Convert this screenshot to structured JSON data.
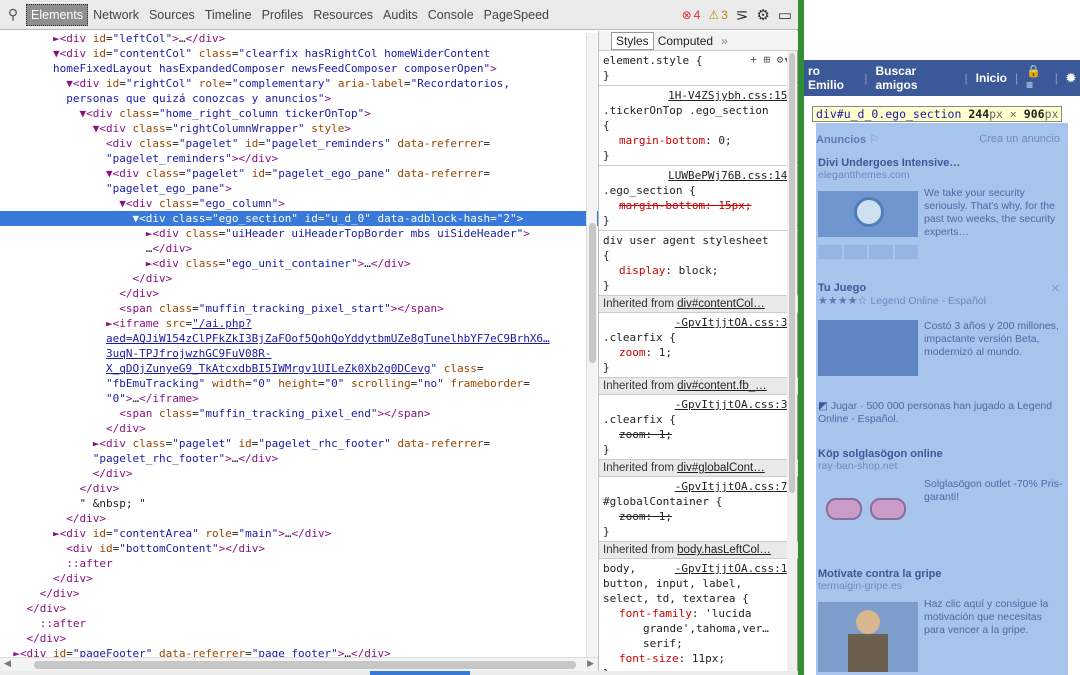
{
  "toolbar": {
    "tabs": [
      "Elements",
      "Network",
      "Sources",
      "Timeline",
      "Profiles",
      "Resources",
      "Audits",
      "Console",
      "PageSpeed"
    ],
    "errors": "4",
    "warnings": "3"
  },
  "dom_lines": [
    {
      "html": "        <span class='tg'>&#9658;&lt;div</span> <span class='an'>id</span>=<span class='av'>\"leftCol\"</span><span class='tg'>&gt;</span>…<span class='tg'>&lt;/div&gt;</span>"
    },
    {
      "html": "        <span class='tg'>&#9660;&lt;div</span> <span class='an'>id</span>=<span class='av'>\"contentCol\"</span> <span class='an'>class</span>=<span class='av'>\"clearfix hasRightCol homeWiderContent</span>"
    },
    {
      "html": "        <span class='av'>homeFixedLayout hasExpandedComposer newsFeedComposer composerOpen\"</span><span class='tg'>&gt;</span>"
    },
    {
      "html": "          <span class='tg'>&#9660;&lt;div</span> <span class='an'>id</span>=<span class='av'>\"rightCol\"</span> <span class='an'>role</span>=<span class='av'>\"complementary\"</span> <span class='an'>aria-label</span>=<span class='av'>\"Recordatorios,</span>"
    },
    {
      "html": "          <span class='av'>personas que quizá conozcas y anuncios\"</span><span class='tg'>&gt;</span>"
    },
    {
      "html": "            <span class='tg'>&#9660;&lt;div</span> <span class='an'>class</span>=<span class='av'>\"home_right_column tickerOnTop\"</span><span class='tg'>&gt;</span>"
    },
    {
      "html": "              <span class='tg'>&#9660;&lt;div</span> <span class='an'>class</span>=<span class='av'>\"rightColumnWrapper\"</span> <span class='an'>style</span><span class='tg'>&gt;</span>"
    },
    {
      "html": "                <span class='tg'>&lt;div</span> <span class='an'>class</span>=<span class='av'>\"pagelet\"</span> <span class='an'>id</span>=<span class='av'>\"pagelet_reminders\"</span> <span class='an'>data-referrer</span>="
    },
    {
      "html": "                <span class='av'>\"pagelet_reminders\"</span><span class='tg'>&gt;&lt;/div&gt;</span>"
    },
    {
      "html": "                <span class='tg'>&#9660;&lt;div</span> <span class='an'>class</span>=<span class='av'>\"pagelet\"</span> <span class='an'>id</span>=<span class='av'>\"pagelet_ego_pane\"</span> <span class='an'>data-referrer</span>="
    },
    {
      "html": "                <span class='av'>\"pagelet_ego_pane\"</span><span class='tg'>&gt;</span>"
    },
    {
      "html": "                  <span class='tg'>&#9660;&lt;div</span> <span class='an'>class</span>=<span class='av'>\"ego_column\"</span><span class='tg'>&gt;</span>"
    },
    {
      "html": "                    <span class='tg'>&#9660;&lt;div</span> <span class='an'>class</span>=<span class='av'>\"ego_section\"</span> <span class='an'>id</span>=<span class='av'>\"u_d_0\"</span> <span class='an'>data-adblock-hash</span>=<span class='av'>\"2\"</span><span class='tg'>&gt;</span>",
      "selected": true
    },
    {
      "html": "                      <span class='tg'>&#9658;&lt;div</span> <span class='an'>class</span>=<span class='av'>\"uiHeader uiHeaderTopBorder mbs uiSideHeader\"</span><span class='tg'>&gt;</span>"
    },
    {
      "html": "                      …<span class='tg'>&lt;/div&gt;</span>"
    },
    {
      "html": "                      <span class='tg'>&#9658;&lt;div</span> <span class='an'>class</span>=<span class='av'>\"ego_unit_container\"</span><span class='tg'>&gt;</span>…<span class='tg'>&lt;/div&gt;</span>"
    },
    {
      "html": "                    <span class='tg'>&lt;/div&gt;</span>"
    },
    {
      "html": "                  <span class='tg'>&lt;/div&gt;</span>"
    },
    {
      "html": "                  <span class='tg'>&lt;span</span> <span class='an'>class</span>=<span class='av'>\"muffin_tracking_pixel_start\"</span><span class='tg'>&gt;&lt;/span&gt;</span>"
    },
    {
      "html": "                <span class='tg'>&#9658;&lt;iframe</span> <span class='an'>src</span>=<span class='lk'>\"/ai.php?</span>"
    },
    {
      "html": "                <span class='lk'>aed=AQJiW154zClPFkZkI3BjZaFOof5QohQoYddytbmUZe8gTunelhbYF7eC9BrhX6…</span>"
    },
    {
      "html": "                <span class='lk'>3uqN-TPJfrojwzhGC9FuV08R-</span>"
    },
    {
      "html": "                <span class='lk'>X_qDOjZunyeG9_TkAtcxdbBI5IWMrgv1UILeZk0Xb2g0DCevg</span><span class='av'>\"</span> <span class='an'>class</span>="
    },
    {
      "html": "                <span class='av'>\"fbEmuTracking\"</span> <span class='an'>width</span>=<span class='av'>\"0\"</span> <span class='an'>height</span>=<span class='av'>\"0\"</span> <span class='an'>scrolling</span>=<span class='av'>\"no\"</span> <span class='an'>frameborder</span>="
    },
    {
      "html": "                <span class='av'>\"0\"</span><span class='tg'>&gt;</span>…<span class='tg'>&lt;/iframe&gt;</span>"
    },
    {
      "html": "                  <span class='tg'>&lt;span</span> <span class='an'>class</span>=<span class='av'>\"muffin_tracking_pixel_end\"</span><span class='tg'>&gt;&lt;/span&gt;</span>"
    },
    {
      "html": "                <span class='tg'>&lt;/div&gt;</span>"
    },
    {
      "html": "              <span class='tg'>&#9658;&lt;div</span> <span class='an'>class</span>=<span class='av'>\"pagelet\"</span> <span class='an'>id</span>=<span class='av'>\"pagelet_rhc_footer\"</span> <span class='an'>data-referrer</span>="
    },
    {
      "html": "              <span class='av'>\"pagelet_rhc_footer\"</span><span class='tg'>&gt;</span>…<span class='tg'>&lt;/div&gt;</span>"
    },
    {
      "html": "              <span class='tg'>&lt;/div&gt;</span>"
    },
    {
      "html": "            <span class='tg'>&lt;/div&gt;</span>"
    },
    {
      "html": "            \" &amp;nbsp; \""
    },
    {
      "html": "          <span class='tg'>&lt;/div&gt;</span>"
    },
    {
      "html": "        <span class='tg'>&#9658;&lt;div</span> <span class='an'>id</span>=<span class='av'>\"contentArea\"</span> <span class='an'>role</span>=<span class='av'>\"main\"</span><span class='tg'>&gt;</span>…<span class='tg'>&lt;/div&gt;</span>"
    },
    {
      "html": "          <span class='tg'>&lt;div</span> <span class='an'>id</span>=<span class='av'>\"bottomContent\"</span><span class='tg'>&gt;&lt;/div&gt;</span>"
    },
    {
      "html": "          <span class='pc'>::after</span>"
    },
    {
      "html": "        <span class='tg'>&lt;/div&gt;</span>"
    },
    {
      "html": "      <span class='tg'>&lt;/div&gt;</span>"
    },
    {
      "html": "    <span class='tg'>&lt;/div&gt;</span>"
    },
    {
      "html": "      <span class='pc'>::after</span>"
    },
    {
      "html": "    <span class='tg'>&lt;/div&gt;</span>"
    },
    {
      "html": "  <span class='tg'>&#9658;&lt;div</span> <span class='an'>id</span>=<span class='av'>\"pageFooter\"</span> <span class='an'>data-referrer</span>=<span class='av'>\"page_footer\"</span><span class='tg'>&gt;</span>…<span class='tg'>&lt;/div&gt;</span>"
    },
    {
      "html": "  <span class='tg'>&lt;/div&gt;</span>"
    }
  ],
  "styles": {
    "tab_styles": "Styles",
    "tab_computed": "Computed",
    "more": "»",
    "element_style": "element.style {",
    "rule1_src": "1H-V4ZSjybh.css:156",
    "rule1_sel": ".tickerOnTop .ego_section",
    "rule1_prop": "margin-bottom",
    "rule1_val": "0;",
    "rule2_src": "LUWBePWj76B.css:140",
    "rule2_sel": ".ego_section {",
    "rule2_prop": "margin-bottom: 15px;",
    "rule3_head": "div  user agent stylesheet",
    "rule3_prop": "display",
    "rule3_val": "block;",
    "inh1": "Inherited from",
    "inh1_link": "div#contentCol…",
    "rule4_src": "-GpvItjjtOA.css:35",
    "rule4_sel": ".clearfix {",
    "rule4_prop": "zoom",
    "rule4_val": "1;",
    "inh2": "Inherited from",
    "inh2_link": "div#content.fb_…",
    "rule5_src": "-GpvItjjtOA.css:35",
    "rule5_sel": ".clearfix {",
    "rule5_prop": "zoom: 1;",
    "inh3": "Inherited from",
    "inh3_link": "div#globalCont…",
    "rule6_src": "-GpvItjjtOA.css:77",
    "rule6_sel": "#globalContainer {",
    "rule6_prop": "zoom: 1;",
    "inh4": "Inherited from",
    "inh4_link": "body.hasLeftCol…",
    "rule7_sel1": "body,",
    "rule7_src": "-GpvItjjtOA.css:19",
    "rule7_sel2": "button, input, label,",
    "rule7_sel3": "select, td, textarea {",
    "rule7_prop1": "font-family",
    "rule7_val1": "'lucida",
    "rule7_val1b": "grande',tahoma,ver…",
    "rule7_val1c": "serif;",
    "rule7_prop2": "font-size",
    "rule7_val2": "11px;"
  },
  "page": {
    "nav": [
      "ro Emilio",
      "|",
      "Buscar amigos",
      "|",
      "Inicio",
      "|",
      "🔒≡",
      "|",
      "✹"
    ],
    "tooltip_id": "div#u_d_0.ego_section",
    "tooltip_w": "244",
    "tooltip_h": "906",
    "tooltip_unit": "px",
    "tooltip_x": "×",
    "ads_header": "Anuncios",
    "create_ad": "Crea un anuncio",
    "ad1_title": "Divi Undergoes Intensive…",
    "ad1_site": "elegantthemes.com",
    "ad1_text": "We take your security seriously. That's why, for the past two weeks, the security experts…",
    "ad2_title": "Tu Juego",
    "ad2_stars": "★★★★☆",
    "ad2_sub": "Legend Online - Español",
    "ad2_text": "Costó 3 años y 200 millones, impactante versión Beta, modernizó al mundo.",
    "ad2_footer": "Jugar · 500 000 personas han jugado a Legend Online - Español.",
    "ad3_title": "Köp solglasögon online",
    "ad3_site": "ray-ban-shop.net",
    "ad3_text": "Solglasögon outlet -70% Pris-garanti!",
    "ad4_title": "Motívate contra la gripe",
    "ad4_site": "termalgin-gripe.es",
    "ad4_text": "Haz clic aquí y consigue la motivación que necesitas para vencer a la gripe."
  }
}
